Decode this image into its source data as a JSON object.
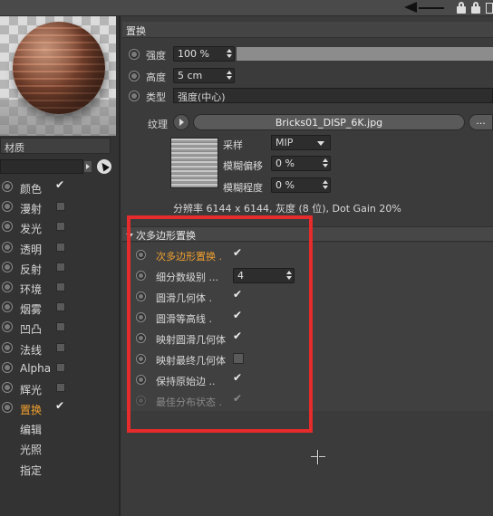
{
  "left": {
    "material_title": "材质",
    "channels": [
      {
        "label": "颜色",
        "checked": true,
        "active": false
      },
      {
        "label": "漫射",
        "checked": false,
        "active": false
      },
      {
        "label": "发光",
        "checked": false,
        "active": false
      },
      {
        "label": "透明",
        "checked": false,
        "active": false
      },
      {
        "label": "反射",
        "checked": false,
        "active": false
      },
      {
        "label": "环境",
        "checked": false,
        "active": false
      },
      {
        "label": "烟雾",
        "checked": false,
        "active": false
      },
      {
        "label": "凹凸",
        "checked": false,
        "active": false
      },
      {
        "label": "法线",
        "checked": false,
        "active": false
      },
      {
        "label": "Alpha",
        "checked": false,
        "active": false
      },
      {
        "label": "辉光",
        "checked": false,
        "active": false
      },
      {
        "label": "置换",
        "checked": true,
        "active": true
      }
    ],
    "extra_items": [
      "编辑",
      "光照",
      "指定"
    ]
  },
  "right": {
    "section_title": "置换",
    "strength": {
      "label": "强度",
      "value": "100 %"
    },
    "height": {
      "label": "高度",
      "value": "5 cm"
    },
    "type": {
      "label": "类型",
      "value": "强度(中心)"
    },
    "texture": {
      "label": "纹理",
      "filename": "Bricks01_DISP_6K.jpg",
      "more": "..."
    },
    "sampling": {
      "label": "采样",
      "value": "MIP"
    },
    "blur_offset": {
      "label": "模糊偏移",
      "value": "0 %"
    },
    "blur_scale": {
      "label": "模糊程度",
      "value": "0 %"
    },
    "info": "分辨率 6144 x 6144, 灰度 (8 位), Dot Gain 20%",
    "subpoly": {
      "title": "次多边形置换",
      "rows": [
        {
          "label": "次多边形置换",
          "dots": ".",
          "checked": true,
          "orange": true,
          "dim": false
        },
        {
          "label": "细分数级别",
          "dots": "...",
          "value": "4",
          "orange": false,
          "dim": false
        },
        {
          "label": "圆滑几何体",
          "dots": ".",
          "checked": true,
          "orange": false,
          "dim": false
        },
        {
          "label": "圆滑等高线",
          "dots": ".",
          "checked": true,
          "orange": false,
          "dim": false
        },
        {
          "label": "映射圆滑几何体",
          "dots": "",
          "checked": true,
          "orange": false,
          "dim": false
        },
        {
          "label": "映射最终几何体",
          "dots": "",
          "checked": false,
          "orange": false,
          "dim": false
        },
        {
          "label": "保持原始边",
          "dots": "..",
          "checked": true,
          "orange": false,
          "dim": false
        },
        {
          "label": "最佳分布状态",
          "dots": ".",
          "checked": true,
          "orange": false,
          "dim": true
        }
      ]
    }
  },
  "colors": {
    "active_label": "#f0a030",
    "highlight_box": "#e52b2b"
  }
}
